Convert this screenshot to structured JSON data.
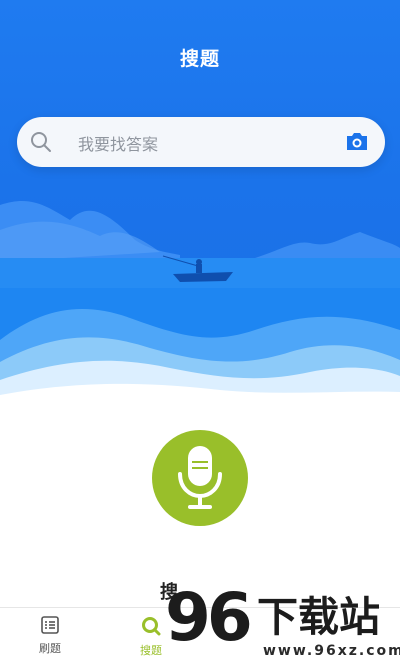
{
  "header": {
    "title": "搜题"
  },
  "search": {
    "placeholder": "我要找答案",
    "left_icon": "search-icon",
    "right_icon": "camera-icon"
  },
  "voice": {
    "icon": "microphone-icon",
    "accent_color": "#99bf2a"
  },
  "promo_partial": "搜",
  "tabbar": {
    "items": [
      {
        "label": "刷题",
        "icon": "list-icon",
        "active": false
      },
      {
        "label": "搜题",
        "icon": "search-tab-icon",
        "active": true
      }
    ]
  },
  "watermark": {
    "digits": "96",
    "brand": "下载站",
    "url": "www.96xz.com"
  },
  "colors": {
    "primary_blue": "#1b73ea",
    "accent_green": "#99bf2a"
  }
}
